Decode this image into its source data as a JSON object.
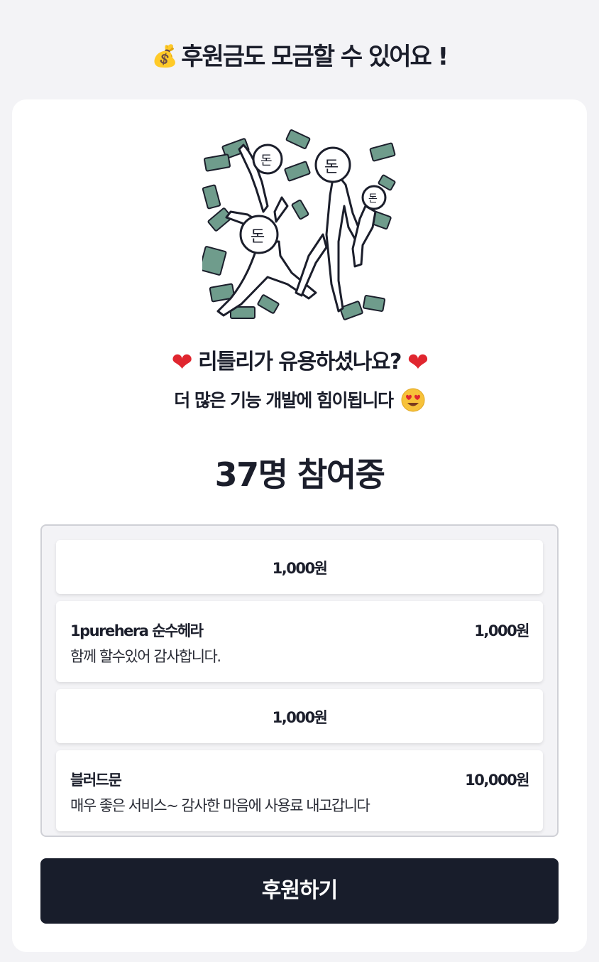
{
  "header": {
    "icon": "money-bag-icon",
    "title": "후원금도 모금할 수 있어요 !"
  },
  "card": {
    "illustration": "money-rain-illustration",
    "headline": "리틀리가 유용하셨나요?",
    "headline_icon": "red-heart-icon",
    "subline": "더 많은 기능 개발에 힘이됩니다",
    "subline_icon": "heart-eyes-smiley-icon",
    "participants": "37명 참여중",
    "donations": [
      {
        "amount": "1,000원"
      },
      {
        "name": "1purehera 순수헤라",
        "amount": "1,000원",
        "message": "함께 할수있어 감사합니다."
      },
      {
        "amount": "1,000원"
      },
      {
        "name": "블러드문",
        "amount": "10,000원",
        "message": "매우 좋은 서비스~ 감사한 마음에 사용료 내고갑니다"
      }
    ],
    "donate_button": "후원하기"
  },
  "colors": {
    "accent": "#181d2b",
    "heart": "#e0262f",
    "bill": "#6f9c8c",
    "background": "#f3f3f6"
  }
}
